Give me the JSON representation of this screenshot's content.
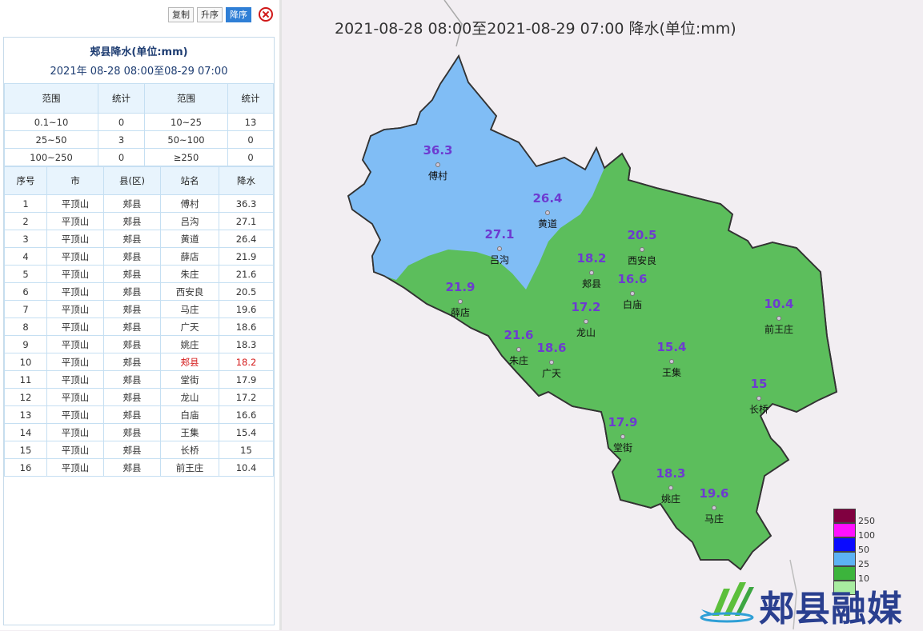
{
  "toolbar": {
    "copy_label": "复制",
    "asc_label": "升序",
    "desc_label": "降序"
  },
  "panel": {
    "title": "郏县降水(单位:mm)",
    "subtitle": "2021年 08-28 08:00至08-29 07:00",
    "range_headers": [
      "范围",
      "统计",
      "范围",
      "统计"
    ],
    "ranges": [
      [
        "0.1~10",
        "0",
        "10~25",
        "13"
      ],
      [
        "25~50",
        "3",
        "50~100",
        "0"
      ],
      [
        "100~250",
        "0",
        "≥250",
        "0"
      ]
    ],
    "data_headers": [
      "序号",
      "市",
      "县(区)",
      "站名",
      "降水"
    ],
    "rows": [
      [
        "1",
        "平顶山",
        "郏县",
        "傅村",
        "36.3"
      ],
      [
        "2",
        "平顶山",
        "郏县",
        "吕沟",
        "27.1"
      ],
      [
        "3",
        "平顶山",
        "郏县",
        "黄道",
        "26.4"
      ],
      [
        "4",
        "平顶山",
        "郏县",
        "薛店",
        "21.9"
      ],
      [
        "5",
        "平顶山",
        "郏县",
        "朱庄",
        "21.6"
      ],
      [
        "6",
        "平顶山",
        "郏县",
        "西安良",
        "20.5"
      ],
      [
        "7",
        "平顶山",
        "郏县",
        "马庄",
        "19.6"
      ],
      [
        "8",
        "平顶山",
        "郏县",
        "广天",
        "18.6"
      ],
      [
        "9",
        "平顶山",
        "郏县",
        "姚庄",
        "18.3"
      ],
      [
        "10",
        "平顶山",
        "郏县",
        "郏县",
        "18.2"
      ],
      [
        "11",
        "平顶山",
        "郏县",
        "堂街",
        "17.9"
      ],
      [
        "12",
        "平顶山",
        "郏县",
        "龙山",
        "17.2"
      ],
      [
        "13",
        "平顶山",
        "郏县",
        "白庙",
        "16.6"
      ],
      [
        "14",
        "平顶山",
        "郏县",
        "王集",
        "15.4"
      ],
      [
        "15",
        "平顶山",
        "郏县",
        "长桥",
        "15"
      ],
      [
        "16",
        "平顶山",
        "郏县",
        "前王庄",
        "10.4"
      ]
    ],
    "highlight_row": 9,
    "highlight_color": "#d41a1a"
  },
  "map": {
    "title": "2021-08-28 08:00至2021-08-29 07:00 降水(单位:mm)",
    "colors": {
      "above_25": "#80bdf5",
      "range_10_25": "#5cbe5c",
      "background": "#f2eef2",
      "value_label": "#6d3bd0"
    },
    "stations": [
      {
        "name": "傅村",
        "value": "36.3"
      },
      {
        "name": "黄道",
        "value": "26.4"
      },
      {
        "name": "吕沟",
        "value": "27.1"
      },
      {
        "name": "西安良",
        "value": "20.5"
      },
      {
        "name": "郏县",
        "value": "18.2"
      },
      {
        "name": "白庙",
        "value": "16.6"
      },
      {
        "name": "薛店",
        "value": "21.9"
      },
      {
        "name": "龙山",
        "value": "17.2"
      },
      {
        "name": "前王庄",
        "value": "10.4"
      },
      {
        "name": "朱庄",
        "value": "21.6"
      },
      {
        "name": "广天",
        "value": "18.6"
      },
      {
        "name": "王集",
        "value": "15.4"
      },
      {
        "name": "长桥",
        "value": "15"
      },
      {
        "name": "堂街",
        "value": "17.9"
      },
      {
        "name": "姚庄",
        "value": "18.3"
      },
      {
        "name": "马庄",
        "value": "19.6"
      }
    ]
  },
  "legend": {
    "items": [
      {
        "label": "250",
        "color": "#800040"
      },
      {
        "label": "100",
        "color": "#ff10ff"
      },
      {
        "label": "50",
        "color": "#0a0aff"
      },
      {
        "label": "25",
        "color": "#5cb2f4"
      },
      {
        "label": "10",
        "color": "#3cb43c"
      },
      {
        "label": "",
        "color": "#a8eca0"
      }
    ]
  },
  "brand": {
    "text": "郏县融媒"
  }
}
